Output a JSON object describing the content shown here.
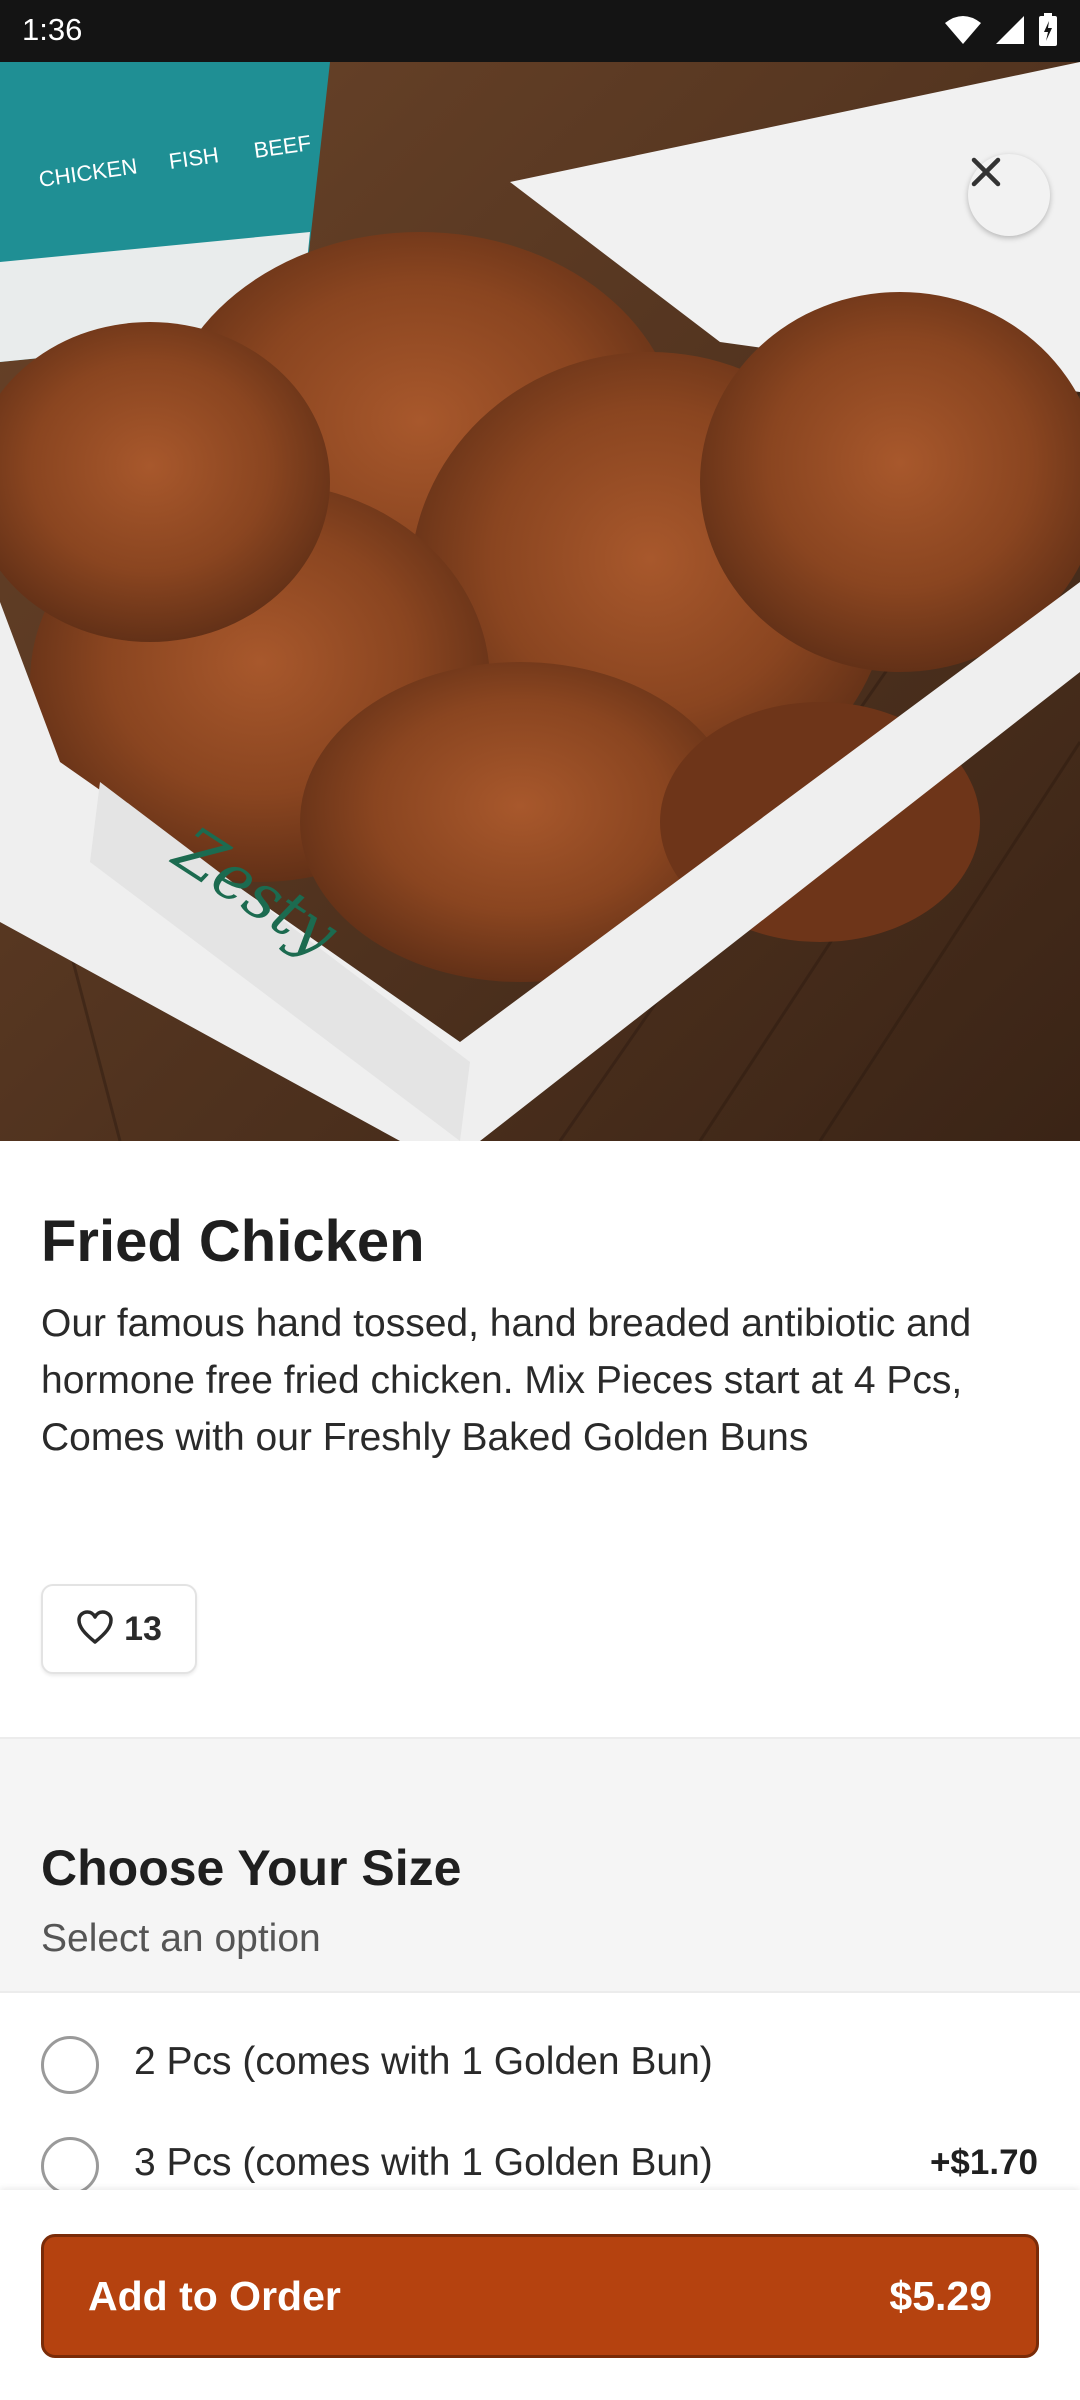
{
  "status_bar": {
    "time": "1:36"
  },
  "item": {
    "title": "Fried Chicken",
    "description": "Our famous hand tossed, hand breaded antibiotic and hormone free fried chicken. Mix Pieces start at 4 Pcs, Comes with our Freshly Baked Golden Buns",
    "favorites_count": "13"
  },
  "size_section": {
    "title": "Choose Your Size",
    "subtitle": "Select an option",
    "options": [
      {
        "label": "2 Pcs (comes with 1 Golden Bun)",
        "price": ""
      },
      {
        "label": "3 Pcs (comes with 1 Golden Bun)",
        "price": "+$1.70"
      }
    ]
  },
  "order_button": {
    "label": "Add to Order",
    "price": "$5.29"
  },
  "hero_image": {
    "box_text": [
      "CHICKEN",
      "FISH",
      "BEEF"
    ],
    "box_script": "Zesty"
  },
  "colors": {
    "accent": "#b5420f",
    "status_bar": "#141414"
  },
  "icons": [
    "wifi-icon",
    "signal-icon",
    "battery-icon",
    "close-icon",
    "heart-icon"
  ]
}
